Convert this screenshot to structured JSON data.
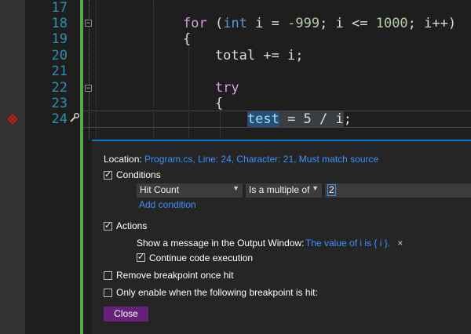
{
  "editor": {
    "lines": [
      {
        "num": "17"
      },
      {
        "num": "18",
        "tokens": {
          "kw": "for",
          "p1": " (",
          "type": "int",
          "p2": " i = ",
          "n1": "-999",
          "p3": "; i <= ",
          "n2": "1000",
          "p4": "; i++)"
        }
      },
      {
        "num": "19",
        "text": "{"
      },
      {
        "num": "20",
        "text": "    total += i;"
      },
      {
        "num": "21"
      },
      {
        "num": "22",
        "kw": "    try"
      },
      {
        "num": "23",
        "text": "    {"
      },
      {
        "num": "24",
        "pre": "        ",
        "hl_var": "test",
        "rest": " = 5 / i",
        "semi": ";"
      }
    ]
  },
  "breakpoint_settings": {
    "location_label": "Location:",
    "location_link": "Program.cs, Line: 24, Character: 21, Must match source",
    "conditions": {
      "label": "Conditions",
      "checked": true
    },
    "condition_type": "Hit Count",
    "condition_op": "Is a multiple of",
    "condition_value": "2",
    "add_condition": "Add condition",
    "actions": {
      "label": "Actions",
      "checked": true
    },
    "show_message_label": "Show a message in the Output Window:",
    "message_value": "The value of i is { i }.",
    "continue_exec": {
      "label": "Continue code execution",
      "checked": true
    },
    "remove_once_hit": {
      "label": "Remove breakpoint once hit",
      "checked": false
    },
    "only_enable": {
      "label": "Only enable when the following breakpoint is hit:",
      "checked": false
    },
    "close_button": "Close"
  },
  "colors": {
    "accent": "#007acc",
    "close_button": "#68217a",
    "link": "#3794ff",
    "breakpoint": "#e51400"
  },
  "icons": [
    "breakpoint-icon",
    "wrench-icon",
    "remove-icon",
    "checkbox-check-icon",
    "chevron-down-icon",
    "fold-icon"
  ]
}
